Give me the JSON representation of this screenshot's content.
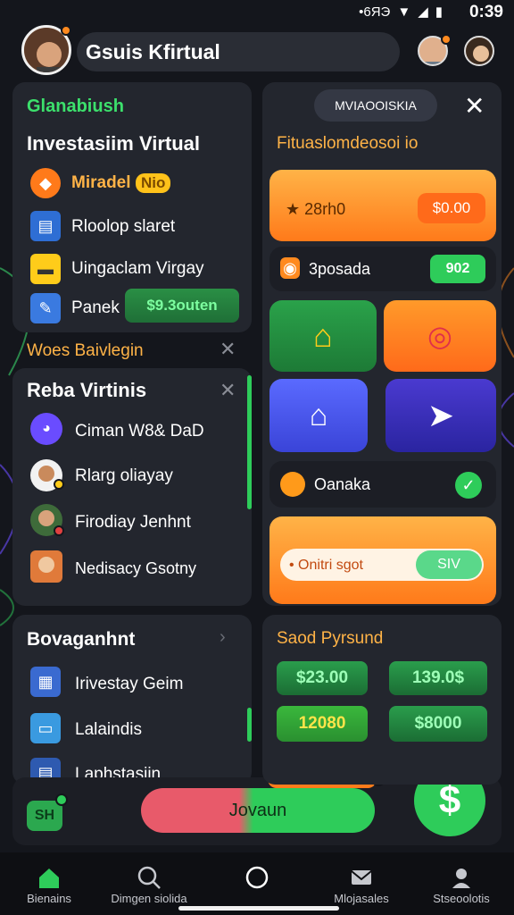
{
  "statusbar": {
    "time": "0:39",
    "carrier": "•6ЯЭ"
  },
  "header": {
    "title": "Gsuis Kfirtual"
  },
  "left_panel_1": {
    "heading": "Glanabiush",
    "title": "Investasiim Virtual",
    "items": [
      {
        "label": "Miradel",
        "badge": "Nio"
      },
      {
        "label": "Rloolop slaret"
      },
      {
        "label": "Uingaclam Virgay"
      },
      {
        "label": "Panek",
        "value": "$9.3outen"
      }
    ],
    "section_label": "Woes Baivlegin"
  },
  "left_panel_2": {
    "title": "Reba Virtinis",
    "people": [
      {
        "name": "Ciman W8& DaD"
      },
      {
        "name": "Rlarg oliayay"
      },
      {
        "name": "Firodiay Jenhnt"
      },
      {
        "name": "Nedisacy Gsotny"
      }
    ]
  },
  "left_panel_3": {
    "title": "Bovaganhnt",
    "items": [
      {
        "label": "Irivestay Geim"
      },
      {
        "label": "Lalaindis"
      },
      {
        "label": "Laphstasiin"
      }
    ],
    "badge": "SH",
    "action_label": "Jovaun"
  },
  "right_panel_1": {
    "top_button": "MVIAOOISKIA",
    "title": "Fituaslomdeosoi io",
    "orange_card": {
      "text": "★ 28rh0",
      "value": "$0.00"
    },
    "row": {
      "label": "3posada",
      "value": "902"
    },
    "status_label": "Oanaka",
    "slider": {
      "label": "• Onitri sgot",
      "value": "SIV"
    }
  },
  "right_panel_2": {
    "title": "Saod Pyrsund",
    "amounts": [
      "$23.00",
      "139.0$",
      "12080",
      "$8000"
    ]
  },
  "fab_label": "$",
  "nav": [
    {
      "label": "Bienains"
    },
    {
      "label": "Dimgen siolida"
    },
    {
      "label": ""
    },
    {
      "label": "Mlojasales"
    },
    {
      "label": "Stseoolotis"
    }
  ],
  "colors": {
    "accent_green": "#2ecc5a",
    "accent_orange": "#ff8a1f",
    "panel": "#23262e"
  }
}
